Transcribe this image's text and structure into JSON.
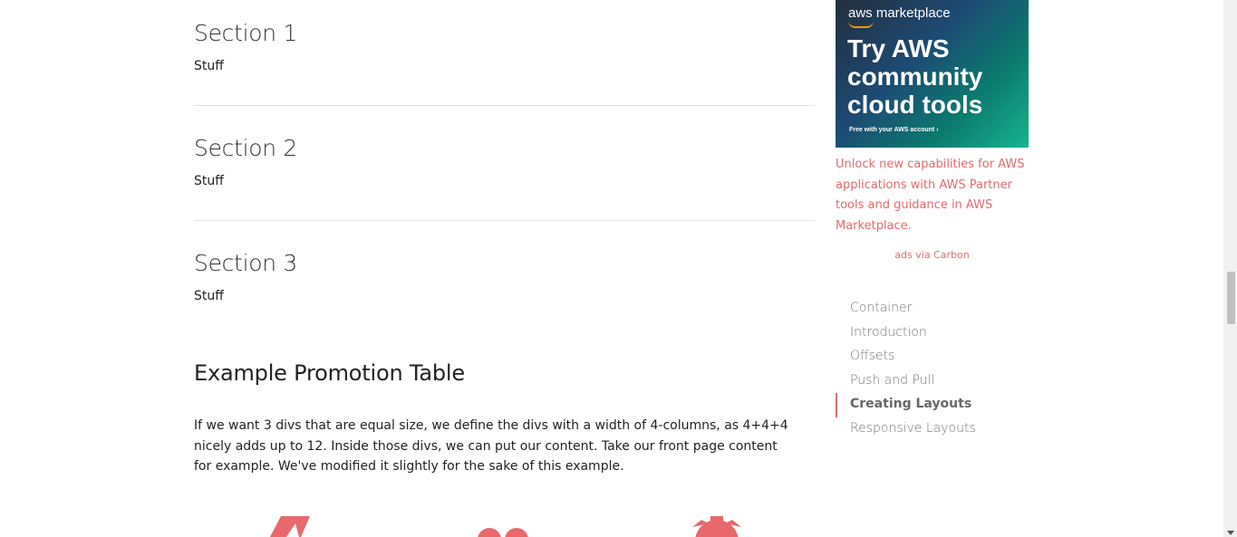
{
  "sections": [
    {
      "title": "Section 1",
      "body": "Stuff"
    },
    {
      "title": "Section 2",
      "body": "Stuff"
    },
    {
      "title": "Section 3",
      "body": "Stuff"
    }
  ],
  "promo": {
    "title": "Example Promotion Table",
    "text": "If we want 3 divs that are equal size, we define the divs with a width of 4-columns, as 4+4+4 nicely adds up to 12. Inside those divs, we can put our content. Take our front page content for example. We've modified it slightly for the sake of this example.",
    "icons": [
      "bolt-icon",
      "heart-icon",
      "gear-icon"
    ]
  },
  "ad": {
    "brand": "aws marketplace",
    "headline": "Try AWS community cloud tools",
    "footnote": "Free with your AWS account ›",
    "description": "Unlock new capabilities for AWS applications with AWS Partner tools and guidance in AWS Marketplace.",
    "via": "ads via Carbon"
  },
  "toc": {
    "items": [
      {
        "label": "Container",
        "active": false
      },
      {
        "label": "Introduction",
        "active": false
      },
      {
        "label": "Offsets",
        "active": false
      },
      {
        "label": "Push and Pull",
        "active": false
      },
      {
        "label": "Creating Layouts",
        "active": true
      },
      {
        "label": "Responsive Layouts",
        "active": false
      }
    ]
  },
  "colors": {
    "accent": "#e8686c"
  }
}
